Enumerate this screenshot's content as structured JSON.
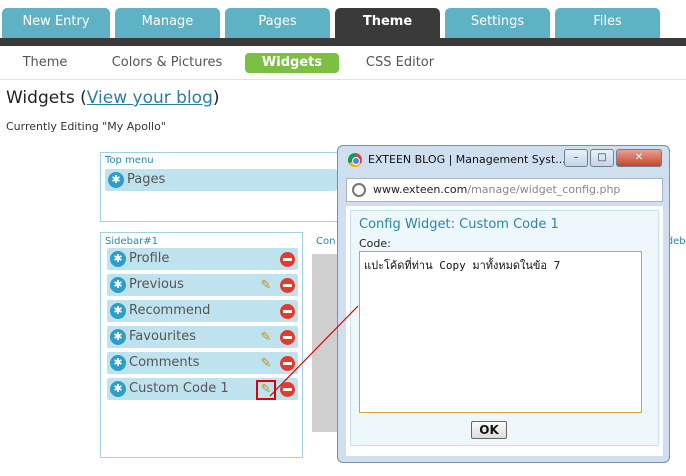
{
  "top_tabs": [
    {
      "label": "New Entry"
    },
    {
      "label": "Manage"
    },
    {
      "label": "Pages"
    },
    {
      "label": "Theme",
      "active": true
    },
    {
      "label": "Settings"
    },
    {
      "label": "Files"
    }
  ],
  "sub_nav": [
    {
      "label": "Theme"
    },
    {
      "label": "Colors & Pictures"
    },
    {
      "label": "Widgets",
      "active": true
    },
    {
      "label": "CSS Editor"
    }
  ],
  "page": {
    "title": "Widgets",
    "paren_open": "(",
    "view_blog_link": "View your blog",
    "paren_close": ")",
    "editing": "Currently Editing \"My Apollo\""
  },
  "top_menu": {
    "label": "Top menu",
    "widgets": [
      {
        "label": "Pages"
      }
    ]
  },
  "sidebar1": {
    "label": "Sidebar#1",
    "widgets": [
      {
        "label": "Profile",
        "editable": false
      },
      {
        "label": "Previous",
        "editable": true
      },
      {
        "label": "Recommend",
        "editable": false
      },
      {
        "label": "Favourites",
        "editable": true
      },
      {
        "label": "Comments",
        "editable": true
      },
      {
        "label": "Custom Code 1",
        "editable": true,
        "highlighted": true
      }
    ]
  },
  "content_area": {
    "label": "Con"
  },
  "sidebar2": {
    "label": "ideba"
  },
  "popup": {
    "title": "EXTEEN BLOG | Management Syst...",
    "minimize": "–",
    "maximize": "□",
    "close": "✕",
    "url_host": "www.exteen.com",
    "url_path": "/manage/widget_config.php",
    "config_title": "Config Widget: Custom Code 1",
    "code_label": "Code:",
    "code_value": "แปะโค้ดที่ท่าน Copy มาทั้งหมดในข้อ 7",
    "ok_label": "OK"
  },
  "colors": {
    "tab": "#5fb1c4",
    "tab_active": "#3a3a3a",
    "subnav_active": "#7bc043",
    "widget_bg": "#bfe3ee",
    "connector_line": "#e00000"
  }
}
